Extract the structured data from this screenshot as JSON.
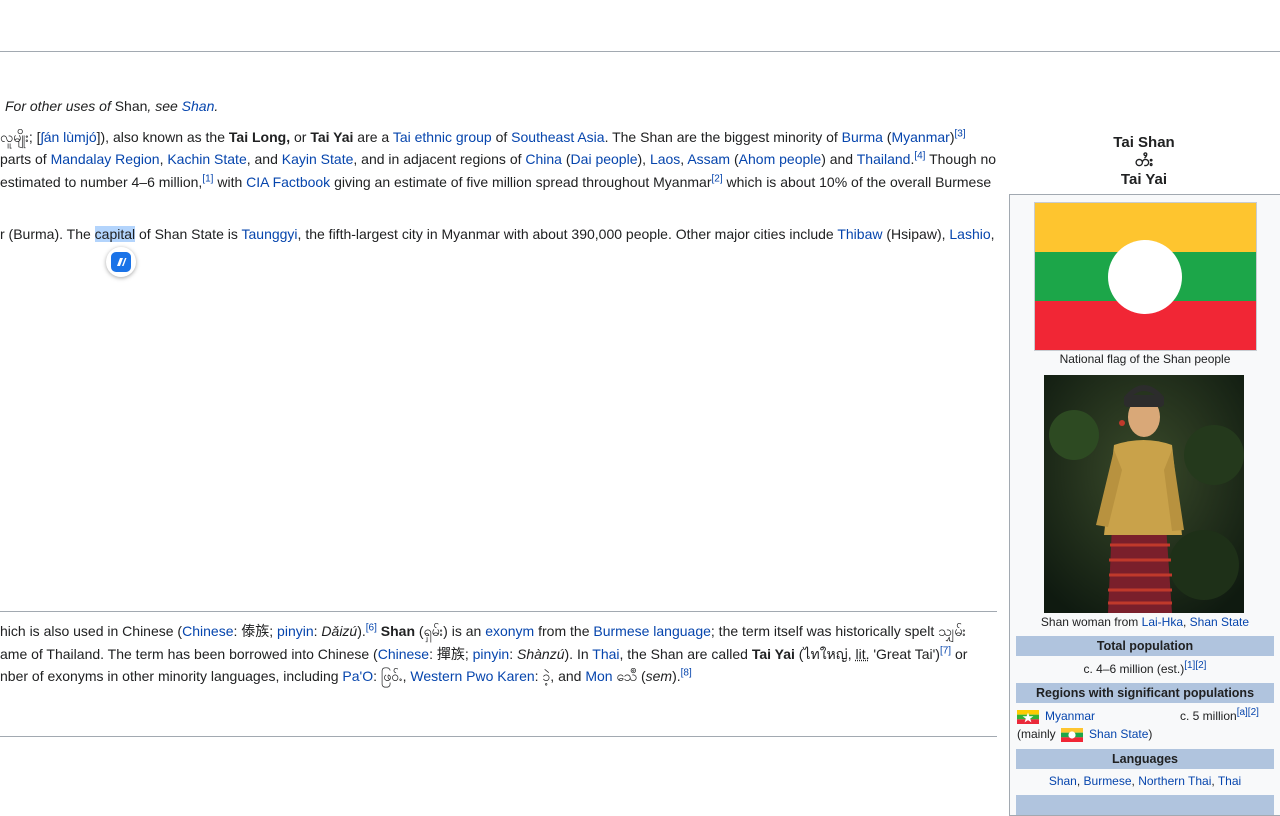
{
  "hatnote": {
    "pre": "For other uses of ",
    "term": "Shan",
    "mid": ", see ",
    "link": "Shan",
    "post": "."
  },
  "intro": {
    "l1": {
      "a": "လူမျိုး; [",
      "b": "ʃán lùmjó",
      "c": "]), also known as the ",
      "d": "Tai Long,",
      "e": " or ",
      "f": "Tai Yai",
      "g": " are a ",
      "h": "Tai ethnic group",
      "i": " of ",
      "j": "Southeast Asia",
      "k": ". The Shan are the biggest minority of ",
      "l": "Burma",
      "m": " (",
      "n": "Myanmar",
      "o": ")",
      "sup": "[3]"
    },
    "l2": {
      "a": "parts of ",
      "b": "Mandalay Region",
      "c": ", ",
      "d": "Kachin State",
      "e": ", and ",
      "f": "Kayin State",
      "g": ", and in adjacent regions of ",
      "h": "China",
      "i": " (",
      "j": "Dai people",
      "k": "), ",
      "l": "Laos",
      "m": ", ",
      "n": "Assam",
      "o": " (",
      "p": "Ahom people",
      "q": ") and ",
      "r": "Thailand",
      "s": ".",
      "sup": "[4]",
      "t": " Though no"
    },
    "l3": {
      "a": "estimated to number 4–6 million,",
      "sup1": "[1]",
      "b": " with ",
      "c": "CIA Factbook",
      "d": " giving an estimate of five million spread throughout Myanmar",
      "sup2": "[2]",
      "e": " which is about 10% of the overall Burmese"
    },
    "l4": {
      "a": "r (Burma). The ",
      "b": "capital",
      "c": " of Shan State is ",
      "d": "Taunggyi",
      "e": ", the fifth-largest city in Myanmar with about 390,000 people. Other major cities include ",
      "f": "Thibaw",
      "g": " (Hsipaw), ",
      "h": "Lashio",
      "i": ","
    }
  },
  "etym": {
    "l1": {
      "a": "hich is also used in Chinese (",
      "b": "Chinese",
      "c": ": 傣族; ",
      "d": "pinyin",
      "e": ": ",
      "f": "Dǎizú",
      "g": ").",
      "sup": "[6]",
      "h": " Shan",
      "i": " (ရှမ်း) is an ",
      "j": "exonym",
      "k": " from the ",
      "l": "Burmese language",
      "m": "; the term itself was historically spelt သျှမ်း"
    },
    "l2": {
      "a": "ame of Thailand. The term has been borrowed into Chinese (",
      "b": "Chinese",
      "c": ": 撣族; ",
      "d": "pinyin",
      "e": ": ",
      "f": "Shànzú",
      "g": "). In ",
      "h": "Thai",
      "i": ", the Shan are called ",
      "j": "Tai Yai",
      "k": " (ไทใหญ่, ",
      "l": "lit.",
      "m": " 'Great Tai')",
      "sup": "[7]",
      "n": " or"
    },
    "l3": {
      "a": "nber of exonyms in other minority languages, including ",
      "b": "Pa'O",
      "c": ": ဖြဝ်ႉ, ",
      "d": "Western Pwo Karen",
      "e": ": ၥဲ့, and ",
      "f": "Mon",
      "g": " သေဳ (",
      "h": "sem",
      "i": ").",
      "sup": "[8]"
    }
  },
  "infobox": {
    "title1": "Tai Shan",
    "title2": "တႆး",
    "title3": "Tai Yai",
    "flag_caption": "National flag of the Shan people",
    "photo_caption_pre": "Shan woman from ",
    "photo_caption_link1": "Lai-Hka",
    "photo_caption_sep": ", ",
    "photo_caption_link2": "Shan State",
    "pop_header": "Total population",
    "pop_value": "c. 4–6 million (est.)",
    "pop_sup": "[1][2]",
    "regions_header": "Regions with significant populations",
    "region_country": "Myanmar",
    "region_value": "c. 5 million",
    "region_sup": "[a][2]",
    "region_note_pre": "(mainly ",
    "region_note_link": "Shan State",
    "region_note_post": ")",
    "lang_header": "Languages",
    "languages": [
      "Shan",
      "Burmese",
      "Northern Thai",
      "Thai"
    ],
    "lang_sep": ", "
  },
  "colors": {
    "link": "#0645ad",
    "header_bg": "#b0c4de",
    "selection": "#b3d4fc",
    "flag_yellow": "#fec52f",
    "flag_green": "#1ca649",
    "flag_red": "#f12635"
  },
  "icons": {
    "popup": "translate-popup-icon"
  }
}
